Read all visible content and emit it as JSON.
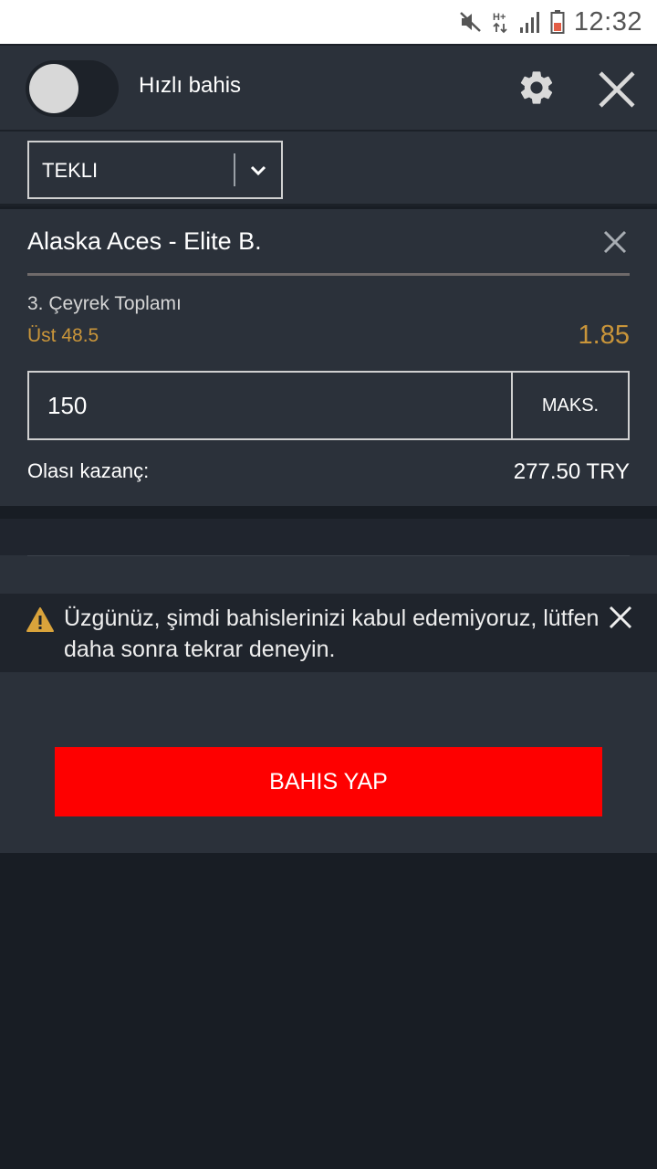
{
  "status_bar": {
    "time": "12:32",
    "icons": [
      "mute-icon",
      "network-hplus-icon",
      "signal-icon",
      "battery-icon"
    ]
  },
  "header": {
    "quick_bet_label": "Hızlı bahis",
    "quick_bet_enabled": false
  },
  "bet_type": {
    "selected": "TEKLI"
  },
  "bet": {
    "match": "Alaska Aces - Elite B.",
    "market": "3. Çeyrek Toplamı",
    "selection": "Üst 48.5",
    "odds": "1.85",
    "stake": "150",
    "max_label": "MAKS.",
    "winnings_label": "Olası kazanç:",
    "winnings_value": "277.50 TRY"
  },
  "warning": {
    "text": "Üzgünüz, şimdi bahislerinizi kabul edemiyoruz, lütfen daha sonra tekrar deneyin."
  },
  "action": {
    "place_bet_label": "BAHIS YAP"
  },
  "colors": {
    "accent_odds": "#c9953a",
    "place_bet": "#fe0000",
    "panel": "#2b313a",
    "background": "#181d24"
  }
}
